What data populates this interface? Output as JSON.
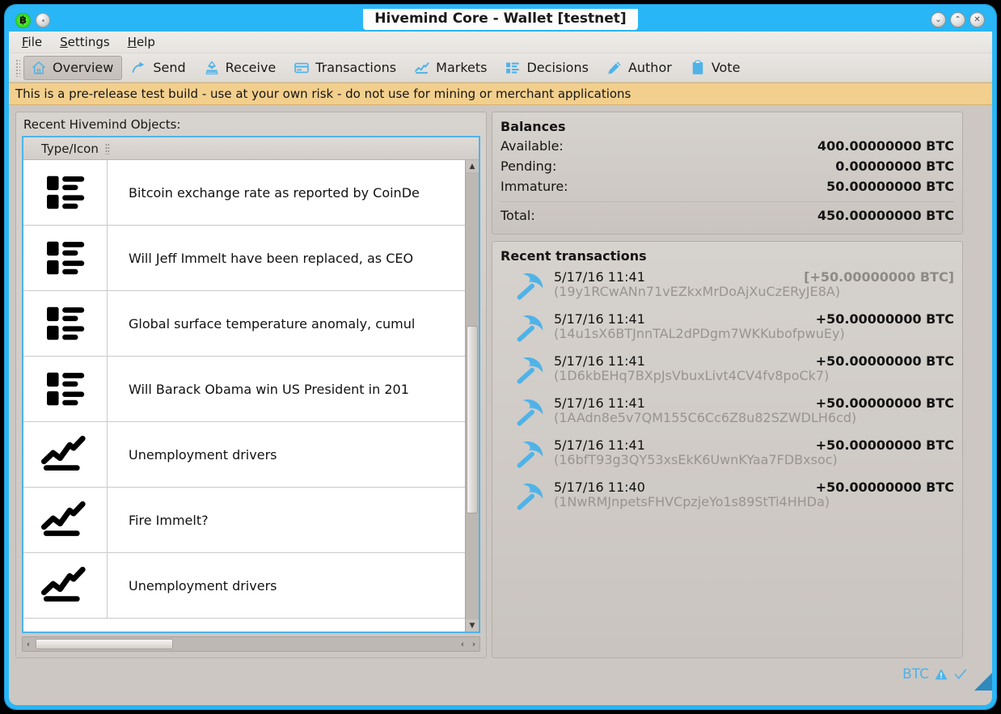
{
  "window": {
    "title": "Hivemind Core - Wallet [testnet]",
    "logo_icon": "bitcoin-logo-icon",
    "secondary_icon": "window-menu-icon",
    "buttons": [
      {
        "name": "minimize-button",
        "glyph": "⌄"
      },
      {
        "name": "maximize-button",
        "glyph": "⌃"
      },
      {
        "name": "close-button",
        "glyph": "✕"
      }
    ]
  },
  "menu": {
    "items": [
      {
        "label": "File",
        "mnemonic": "F",
        "rest": "ile"
      },
      {
        "label": "Settings",
        "mnemonic": "S",
        "rest": "ettings"
      },
      {
        "label": "Help",
        "mnemonic": "H",
        "rest": "elp"
      }
    ]
  },
  "toolbar": {
    "items": [
      {
        "label": "Overview",
        "icon": "home-icon",
        "selected": true
      },
      {
        "label": "Send",
        "icon": "send-arrow-icon",
        "selected": false
      },
      {
        "label": "Receive",
        "icon": "receive-icon",
        "selected": false
      },
      {
        "label": "Transactions",
        "icon": "card-icon",
        "selected": false
      },
      {
        "label": "Markets",
        "icon": "chart-line-icon",
        "selected": false
      },
      {
        "label": "Decisions",
        "icon": "list-icon",
        "selected": false
      },
      {
        "label": "Author",
        "icon": "pencil-icon",
        "selected": false
      },
      {
        "label": "Vote",
        "icon": "clipboard-icon",
        "selected": false
      }
    ]
  },
  "banner": {
    "text": "This is a pre-release test build - use at your own risk - do not use for mining or merchant applications",
    "background": "#f2cf8d"
  },
  "left_panel": {
    "title": "Recent Hivemind Objects:",
    "column_header": "Type/Icon",
    "rows": [
      {
        "icon": "list-icon",
        "label": "Bitcoin exchange rate as reported by CoinDe"
      },
      {
        "icon": "list-icon",
        "label": "Will Jeff Immelt have been replaced, as CEO"
      },
      {
        "icon": "list-icon",
        "label": "Global surface temperature anomaly, cumul"
      },
      {
        "icon": "list-icon",
        "label": "Will Barack Obama win US President in 201"
      },
      {
        "icon": "chart-line-icon",
        "label": "Unemployment drivers"
      },
      {
        "icon": "chart-line-icon",
        "label": "Fire Immelt?"
      },
      {
        "icon": "chart-line-icon",
        "label": "Unemployment drivers"
      }
    ]
  },
  "balances": {
    "title": "Balances",
    "rows": [
      {
        "label": "Available:",
        "value": "400.00000000 BTC"
      },
      {
        "label": "Pending:",
        "value": "0.00000000 BTC"
      },
      {
        "label": "Immature:",
        "value": "50.00000000 BTC"
      }
    ],
    "total": {
      "label": "Total:",
      "value": "450.00000000 BTC"
    }
  },
  "transactions": {
    "title": "Recent transactions",
    "rows": [
      {
        "icon": "pickaxe-icon",
        "date": "5/17/16 11:41",
        "amount": "[+50.00000000 BTC]",
        "address": "(19y1RCwANn71vEZkxMrDoAjXuCzERyJE8A)",
        "immature": true
      },
      {
        "icon": "pickaxe-icon",
        "date": "5/17/16 11:41",
        "amount": "+50.00000000 BTC",
        "address": "(14u1sX6BTJnnTAL2dPDgm7WKKubofpwuEy)",
        "immature": false
      },
      {
        "icon": "pickaxe-icon",
        "date": "5/17/16 11:41",
        "amount": "+50.00000000 BTC",
        "address": "(1D6kbEHq7BXpJsVbuxLivt4CV4fv8poCk7)",
        "immature": false
      },
      {
        "icon": "pickaxe-icon",
        "date": "5/17/16 11:41",
        "amount": "+50.00000000 BTC",
        "address": "(1AAdn8e5v7QM155C6Cc6Z8u82SZWDLH6cd)",
        "immature": false
      },
      {
        "icon": "pickaxe-icon",
        "date": "5/17/16 11:41",
        "amount": "+50.00000000 BTC",
        "address": "(16bfT93g3QY53xsEkK6UwnKYaa7FDBxsoc)",
        "immature": false
      },
      {
        "icon": "pickaxe-icon",
        "date": "5/17/16 11:40",
        "amount": "+50.00000000 BTC",
        "address": "(1NwRMJnpetsFHVCpzjeYo1s89StTi4HHDa)",
        "immature": false
      }
    ]
  },
  "status_bar": {
    "unit_label": "BTC",
    "icons": [
      "warning-triangle-icon",
      "sync-check-icon"
    ],
    "accent_color": "#4fb3e8"
  }
}
